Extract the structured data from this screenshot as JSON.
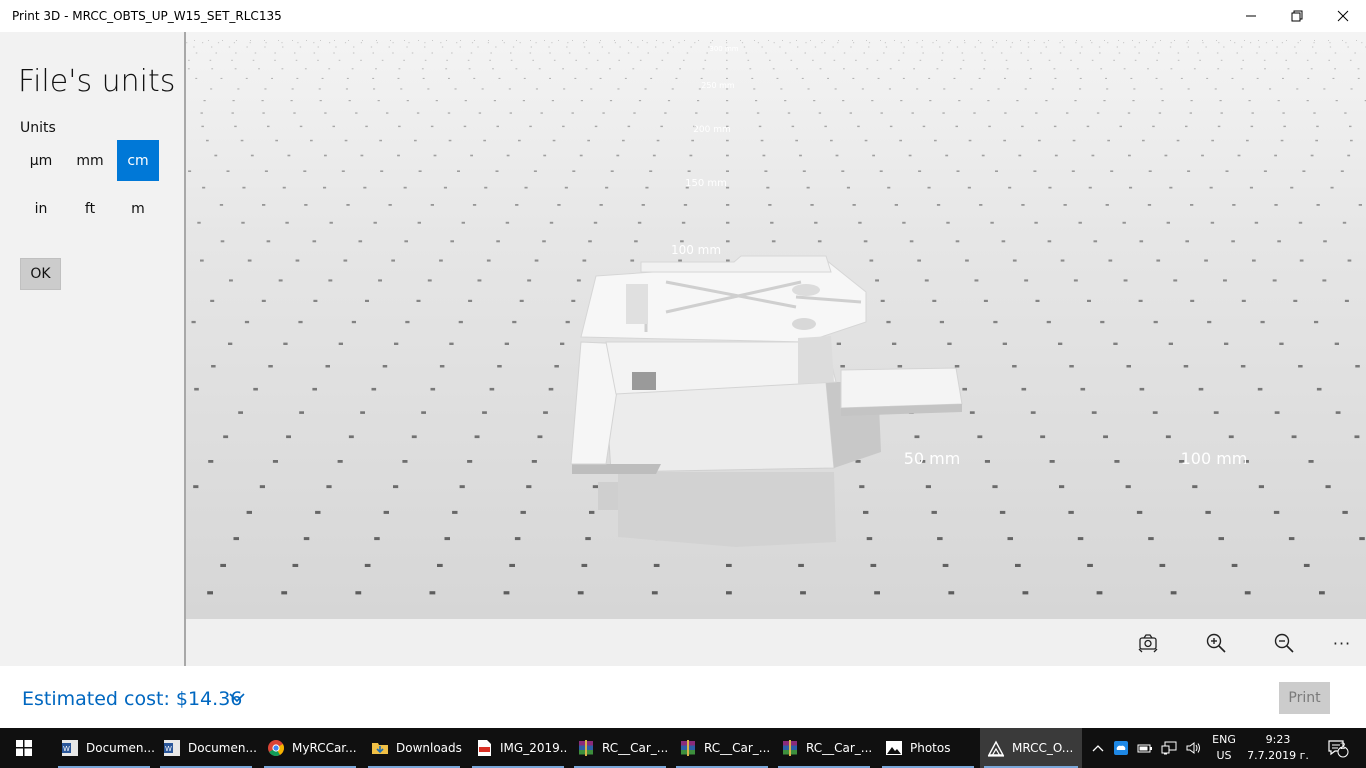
{
  "window": {
    "title": "Print 3D - MRCC_OBTS_UP_W15_SET_RLC135"
  },
  "panel": {
    "title": "File's units",
    "units_label": "Units",
    "units": [
      "µm",
      "mm",
      "cm",
      "in",
      "ft",
      "m"
    ],
    "selected_unit": "cm",
    "ok_label": "OK"
  },
  "viewport": {
    "scale_labels": [
      "300 mm",
      "250 mm",
      "200 mm",
      "150 mm",
      "100 mm",
      "50 mm",
      "100 mm"
    ]
  },
  "toolbar": {
    "icons": [
      "view-reset-icon",
      "zoom-in-icon",
      "zoom-out-icon",
      "more-icon"
    ],
    "more_label": "···"
  },
  "cost": {
    "label": "Estimated cost: $14.36",
    "print_label": "Print"
  },
  "taskbar": {
    "items": [
      {
        "label": "Documen...",
        "icon": "word-icon"
      },
      {
        "label": "Documen...",
        "icon": "word-icon"
      },
      {
        "label": "MyRCCar...",
        "icon": "chrome-icon"
      },
      {
        "label": "Downloads",
        "icon": "folder-icon"
      },
      {
        "label": "IMG_2019...",
        "icon": "pdf-icon"
      },
      {
        "label": "RC__Car_...",
        "icon": "winrar-icon"
      },
      {
        "label": "RC__Car_...",
        "icon": "winrar-icon"
      },
      {
        "label": "RC__Car_...",
        "icon": "winrar-icon"
      },
      {
        "label": "Photos",
        "icon": "photos-icon"
      },
      {
        "label": "MRCC_O...",
        "icon": "print3d-icon"
      }
    ],
    "lang_top": "ENG",
    "lang_bottom": "US",
    "time": "9:23",
    "date": "7.7.2019 г.",
    "notification_count": "2",
    "colors": {
      "accent": "#0078d7",
      "cost_text": "#0067c0"
    }
  }
}
